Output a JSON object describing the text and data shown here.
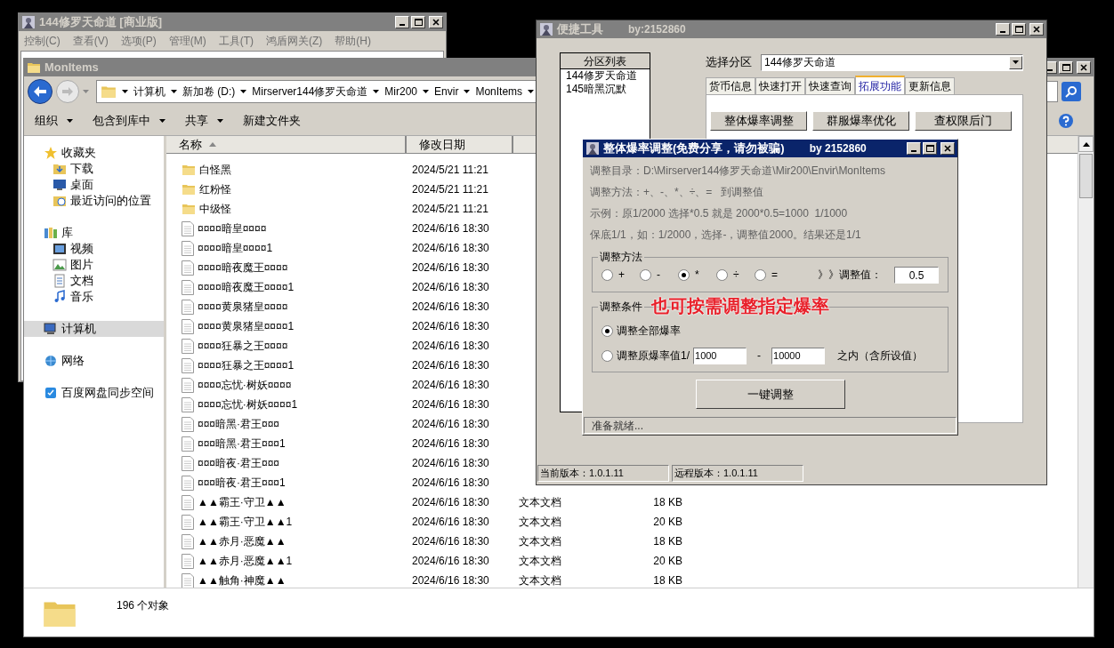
{
  "back_window": {
    "title": "144修罗天命道 [商业版]",
    "active": false,
    "menu": [
      "控制(C)",
      "查看(V)",
      "选项(P)",
      "管理(M)",
      "工具(T)",
      "鸿盾网关(Z)",
      "帮助(H)"
    ]
  },
  "explorer": {
    "title": "MonItems",
    "active": false,
    "address": [
      "计算机",
      "新加卷 (D:)",
      "Mirserver144修罗天命道",
      "Mir200",
      "Envir",
      "MonItems"
    ],
    "toolbar": [
      {
        "label": "组织",
        "dropdown": true
      },
      {
        "label": "包含到库中",
        "dropdown": true
      },
      {
        "label": "共享",
        "dropdown": true
      },
      {
        "label": "新建文件夹",
        "dropdown": false
      }
    ],
    "nav": [
      {
        "kind": "star",
        "label": "收藏夹",
        "selected": false,
        "children": [
          {
            "kind": "download",
            "label": "下载",
            "selected": false
          },
          {
            "kind": "desktop",
            "label": "桌面",
            "selected": false
          },
          {
            "kind": "recent",
            "label": "最近访问的位置",
            "selected": false
          }
        ]
      },
      {
        "kind": "library",
        "label": "库",
        "selected": false,
        "children": [
          {
            "kind": "video",
            "label": "视频",
            "selected": false
          },
          {
            "kind": "picture",
            "label": "图片",
            "selected": false
          },
          {
            "kind": "document",
            "label": "文档",
            "selected": false
          },
          {
            "kind": "music",
            "label": "音乐",
            "selected": false
          }
        ]
      },
      {
        "kind": "computer",
        "label": "计算机",
        "selected": true
      },
      {
        "kind": "network",
        "label": "网络",
        "selected": false
      },
      {
        "kind": "cloud",
        "label": "百度网盘同步空间",
        "selected": false
      }
    ],
    "columns": [
      {
        "label": "名称",
        "sorted": true
      },
      {
        "label": "修改日期",
        "sorted": false
      }
    ],
    "rows": [
      {
        "kind": "folder",
        "name": "白怪黑",
        "modified": "2024/5/21 11:21"
      },
      {
        "kind": "folder",
        "name": "红粉怪",
        "modified": "2024/5/21 11:21"
      },
      {
        "kind": "folder",
        "name": "中级怪",
        "modified": "2024/5/21 11:21"
      },
      {
        "kind": "file",
        "name": "¤¤¤¤暗皇¤¤¤¤",
        "modified": "2024/6/16 18:30"
      },
      {
        "kind": "file",
        "name": "¤¤¤¤暗皇¤¤¤¤1",
        "modified": "2024/6/16 18:30"
      },
      {
        "kind": "file",
        "name": "¤¤¤¤暗夜魔王¤¤¤¤",
        "modified": "2024/6/16 18:30"
      },
      {
        "kind": "file",
        "name": "¤¤¤¤暗夜魔王¤¤¤¤1",
        "modified": "2024/6/16 18:30"
      },
      {
        "kind": "file",
        "name": "¤¤¤¤黄泉猪皇¤¤¤¤",
        "modified": "2024/6/16 18:30"
      },
      {
        "kind": "file",
        "name": "¤¤¤¤黄泉猪皇¤¤¤¤1",
        "modified": "2024/6/16 18:30"
      },
      {
        "kind": "file",
        "name": "¤¤¤¤狂暴之王¤¤¤¤",
        "modified": "2024/6/16 18:30"
      },
      {
        "kind": "file",
        "name": "¤¤¤¤狂暴之王¤¤¤¤1",
        "modified": "2024/6/16 18:30"
      },
      {
        "kind": "file",
        "name": "¤¤¤¤忘忧·树妖¤¤¤¤",
        "modified": "2024/6/16 18:30"
      },
      {
        "kind": "file",
        "name": "¤¤¤¤忘忧·树妖¤¤¤¤1",
        "modified": "2024/6/16 18:30"
      },
      {
        "kind": "file",
        "name": "¤¤¤暗黑·君王¤¤¤",
        "modified": "2024/6/16 18:30"
      },
      {
        "kind": "file",
        "name": "¤¤¤暗黑·君王¤¤¤1",
        "modified": "2024/6/16 18:30"
      },
      {
        "kind": "file",
        "name": "¤¤¤暗夜·君王¤¤¤",
        "modified": "2024/6/16 18:30"
      },
      {
        "kind": "file",
        "name": "¤¤¤暗夜·君王¤¤¤1",
        "modified": "2024/6/16 18:30"
      },
      {
        "kind": "file",
        "name": "▲▲霸王·守卫▲▲",
        "modified": "2024/6/16 18:30",
        "type": "文本文档",
        "size": "18 KB"
      },
      {
        "kind": "file",
        "name": "▲▲霸王·守卫▲▲1",
        "modified": "2024/6/16 18:30",
        "type": "文本文档",
        "size": "20 KB"
      },
      {
        "kind": "file",
        "name": "▲▲赤月·恶魔▲▲",
        "modified": "2024/6/16 18:30",
        "type": "文本文档",
        "size": "18 KB"
      },
      {
        "kind": "file",
        "name": "▲▲赤月·恶魔▲▲1",
        "modified": "2024/6/16 18:30",
        "type": "文本文档",
        "size": "20 KB"
      },
      {
        "kind": "file",
        "name": "▲▲触角·神魔▲▲",
        "modified": "2024/6/16 18:30",
        "type": "文本文档",
        "size": "18 KB"
      }
    ],
    "status": "196 个对象"
  },
  "tool_window": {
    "title": "便捷工具",
    "author": "by:2152860",
    "active": false,
    "list_header": "分区列表",
    "list_items": [
      {
        "label": "144修罗天命道",
        "selected": false
      },
      {
        "label": "145暗黑沉默",
        "selected": false
      }
    ],
    "select_label": "选择分区",
    "select_value": "144修罗天命道",
    "tabs": [
      {
        "label": "货币信息",
        "selected": false
      },
      {
        "label": "快速打开",
        "selected": false
      },
      {
        "label": "快速查询",
        "selected": false
      },
      {
        "label": "拓展功能",
        "selected": true
      },
      {
        "label": "更新信息",
        "selected": false
      }
    ],
    "buttons": [
      "整体爆率调整",
      "群服爆率优化",
      "查权限后门"
    ],
    "status": [
      "当前版本：1.0.1.11",
      "远程版本：1.0.1.11"
    ]
  },
  "dialog": {
    "title": "整体爆率调整(免费分享，请勿被骗)",
    "author": "by 2152860",
    "active": true,
    "info": [
      "调整目录：D:\\Mirserver144修罗天命道\\Mir200\\Envir\\MonItems",
      "调整方法：+、-、*、÷、=   到调整值",
      "示例：原1/2000 选择*0.5 就是 2000*0.5=1000  1/1000",
      "保底1/1，如：1/2000，选择-，调整值2000。结果还是1/1"
    ],
    "method_group": "调整方法",
    "methods": [
      {
        "label": "+",
        "selected": false
      },
      {
        "label": "-",
        "selected": false
      },
      {
        "label": "*",
        "selected": true
      },
      {
        "label": "÷",
        "selected": false
      },
      {
        "label": "=",
        "selected": false
      }
    ],
    "value_label": "》》调整值：",
    "value": "0.5",
    "condition_group": "调整条件",
    "annotation": "也可按需调整指定爆率",
    "conditions": [
      {
        "kind": "plain",
        "label": "调整全部爆率",
        "selected": true
      },
      {
        "kind": "range",
        "label": "调整原爆率值1/",
        "from": "1000",
        "separator": "-",
        "to": "10000",
        "suffix": "之内（含所设值）",
        "selected": false
      }
    ],
    "action": "一键调整",
    "status": "准备就绪..."
  }
}
